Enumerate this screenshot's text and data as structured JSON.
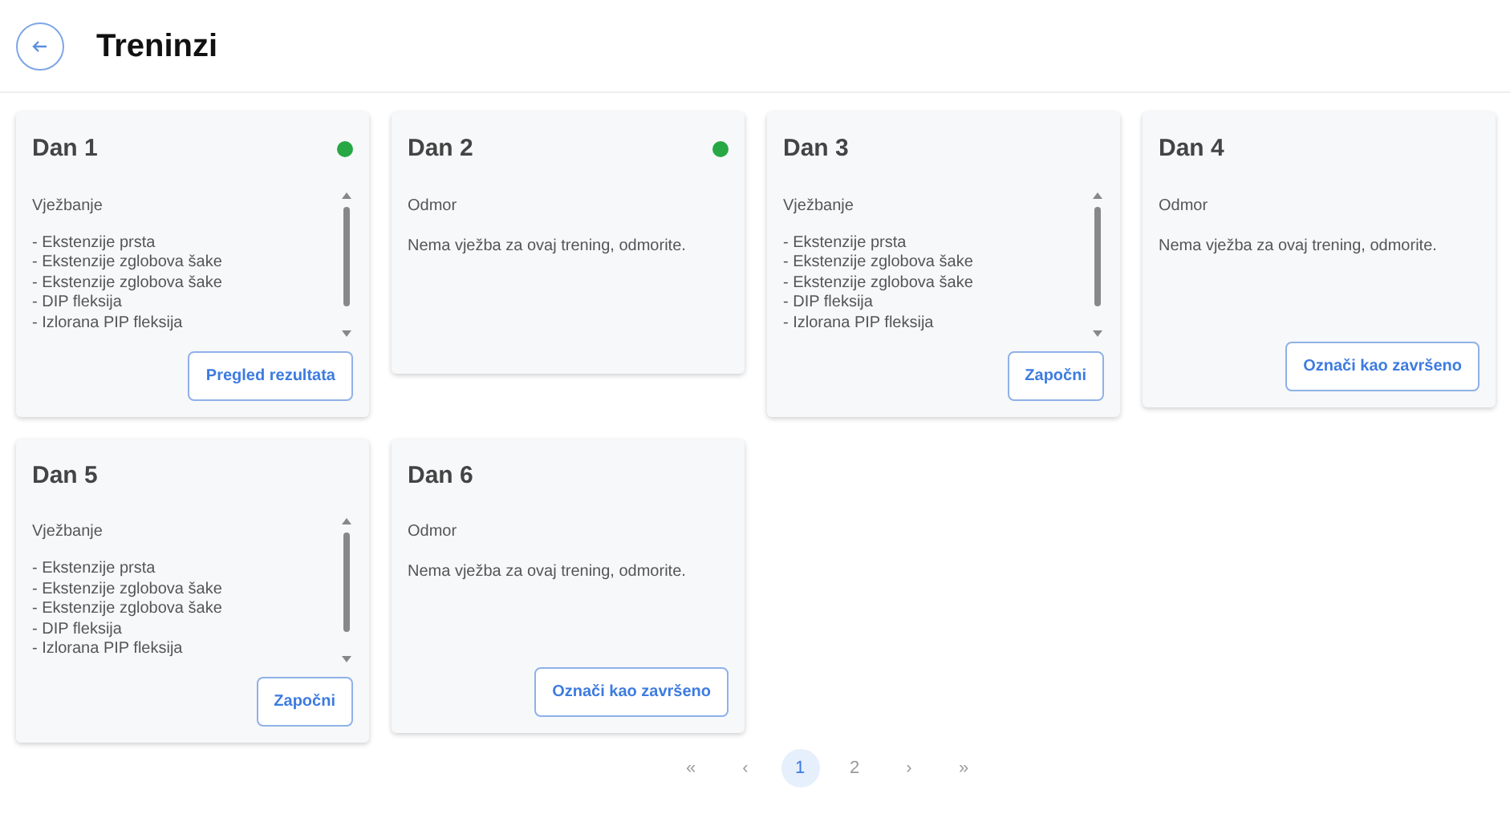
{
  "header": {
    "title": "Treninzi"
  },
  "days": [
    {
      "title": "Dan 1",
      "completed": true,
      "kind": "exercise",
      "type_label": "Vježbanje",
      "exercises": [
        "- Ekstenzije prsta",
        "- Ekstenzije zglobova šake",
        "- Ekstenzije zglobova šake",
        "- DIP fleksija",
        "- Izlorana PIP fleksija"
      ],
      "button": "Pregled rezultata"
    },
    {
      "title": "Dan 2",
      "completed": true,
      "kind": "rest",
      "type_label": "Odmor",
      "message": "Nema vježba za ovaj trening, odmorite."
    },
    {
      "title": "Dan 3",
      "completed": false,
      "kind": "exercise",
      "type_label": "Vježbanje",
      "exercises": [
        "- Ekstenzije prsta",
        "- Ekstenzije zglobova šake",
        "- Ekstenzije zglobova šake",
        "- DIP fleksija",
        "- Izlorana PIP fleksija"
      ],
      "button": "Započni"
    },
    {
      "title": "Dan 4",
      "completed": false,
      "kind": "rest",
      "type_label": "Odmor",
      "message": "Nema vježba za ovaj trening, odmorite.",
      "button": "Označi kao završeno"
    },
    {
      "title": "Dan 5",
      "completed": false,
      "kind": "exercise",
      "type_label": "Vježbanje",
      "exercises": [
        "- Ekstenzije prsta",
        "- Ekstenzije zglobova šake",
        "- Ekstenzije zglobova šake",
        "- DIP fleksija",
        "- Izlorana PIP fleksija"
      ],
      "button": "Započni"
    },
    {
      "title": "Dan 6",
      "completed": false,
      "kind": "rest",
      "type_label": "Odmor",
      "message": "Nema vježba za ovaj trening, odmorite.",
      "button": "Označi kao završeno"
    }
  ],
  "pagination": [
    {
      "label": "«",
      "selected": false
    },
    {
      "label": "‹",
      "selected": false
    },
    {
      "label": "1",
      "selected": true
    },
    {
      "label": "2",
      "selected": false
    },
    {
      "label": "›",
      "selected": false
    },
    {
      "label": "»",
      "selected": false
    }
  ]
}
